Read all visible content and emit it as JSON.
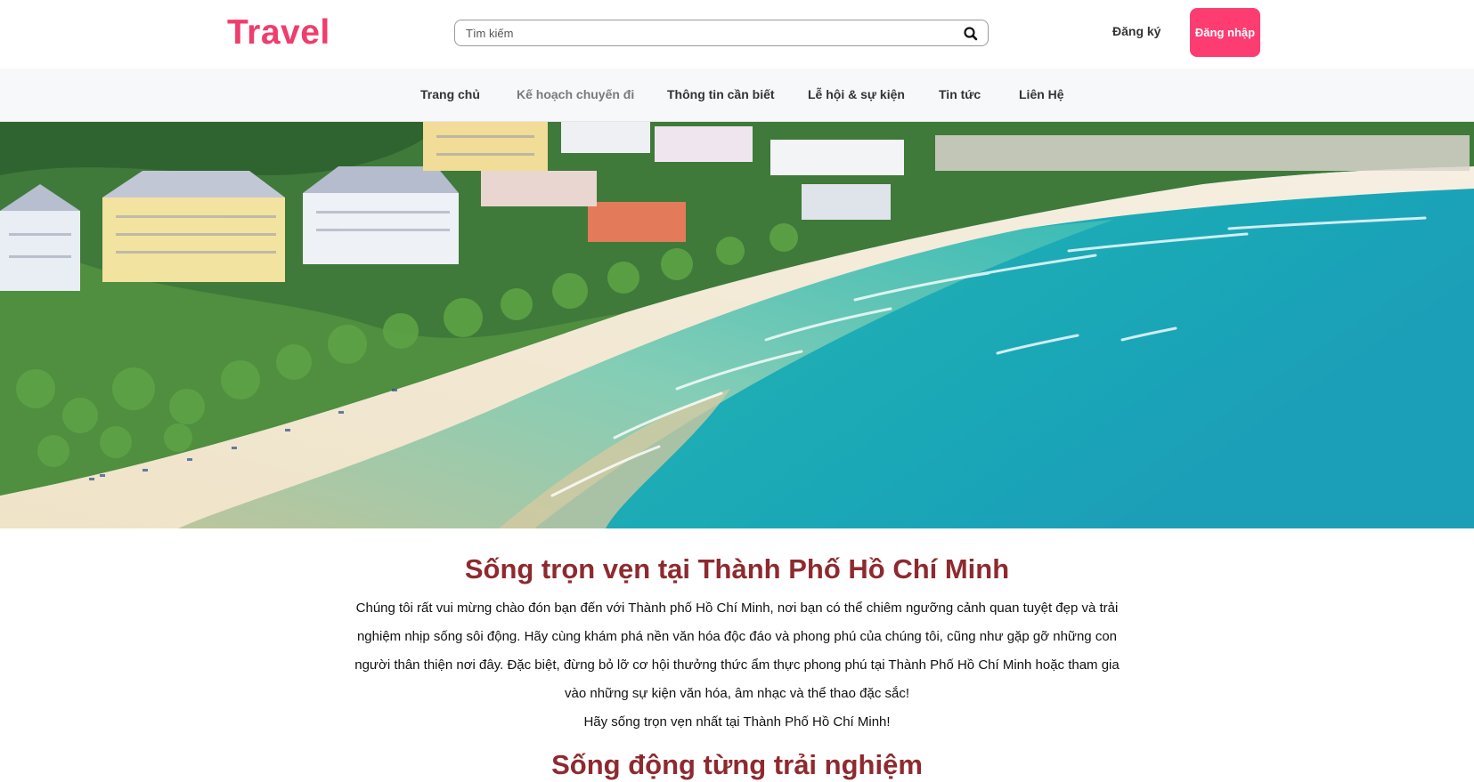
{
  "header": {
    "logo": "Travel",
    "search_placeholder": "Tìm kiếm",
    "search_icon": "search-icon",
    "register_label": "Đăng ký",
    "login_label": "Đăng nhập",
    "brand_color": "#ef3d6c",
    "login_bg": "#fd3d72"
  },
  "nav": {
    "items": [
      {
        "label": "Trang chủ"
      },
      {
        "label": "Kế hoạch chuyến đi"
      },
      {
        "label": "Thông tin cần biết"
      },
      {
        "label": "Lễ hội & sự kiện"
      },
      {
        "label": "Tin tức"
      },
      {
        "label": "Liên Hệ"
      }
    ]
  },
  "main": {
    "title": "Sống trọn vẹn tại Thành Phố Hồ Chí Minh",
    "intro": "Chúng tôi rất vui mừng chào đón bạn đến với Thành phố Hồ Chí Minh, nơi bạn có thể chiêm ngưỡng cảnh quan tuyệt đẹp và trải nghiệm nhịp sống sôi động. Hãy cùng khám phá nền văn hóa độc đáo và phong phú của chúng tôi, cũng như gặp gỡ những con người thân thiện nơi đây. Đặc biệt, đừng bỏ lỡ cơ hội thưởng thức ẩm thực phong phú tại Thành Phố Hồ Chí Minh hoặc tham gia vào những sự kiện văn hóa, âm nhạc và thể thao đặc sắc!",
    "tagline": "Hãy sống trọn vẹn nhất tại Thành Phố Hồ Chí Minh!",
    "subtitle": "Sống động từng trải nghiệm",
    "title_color": "#8e2a2f"
  }
}
